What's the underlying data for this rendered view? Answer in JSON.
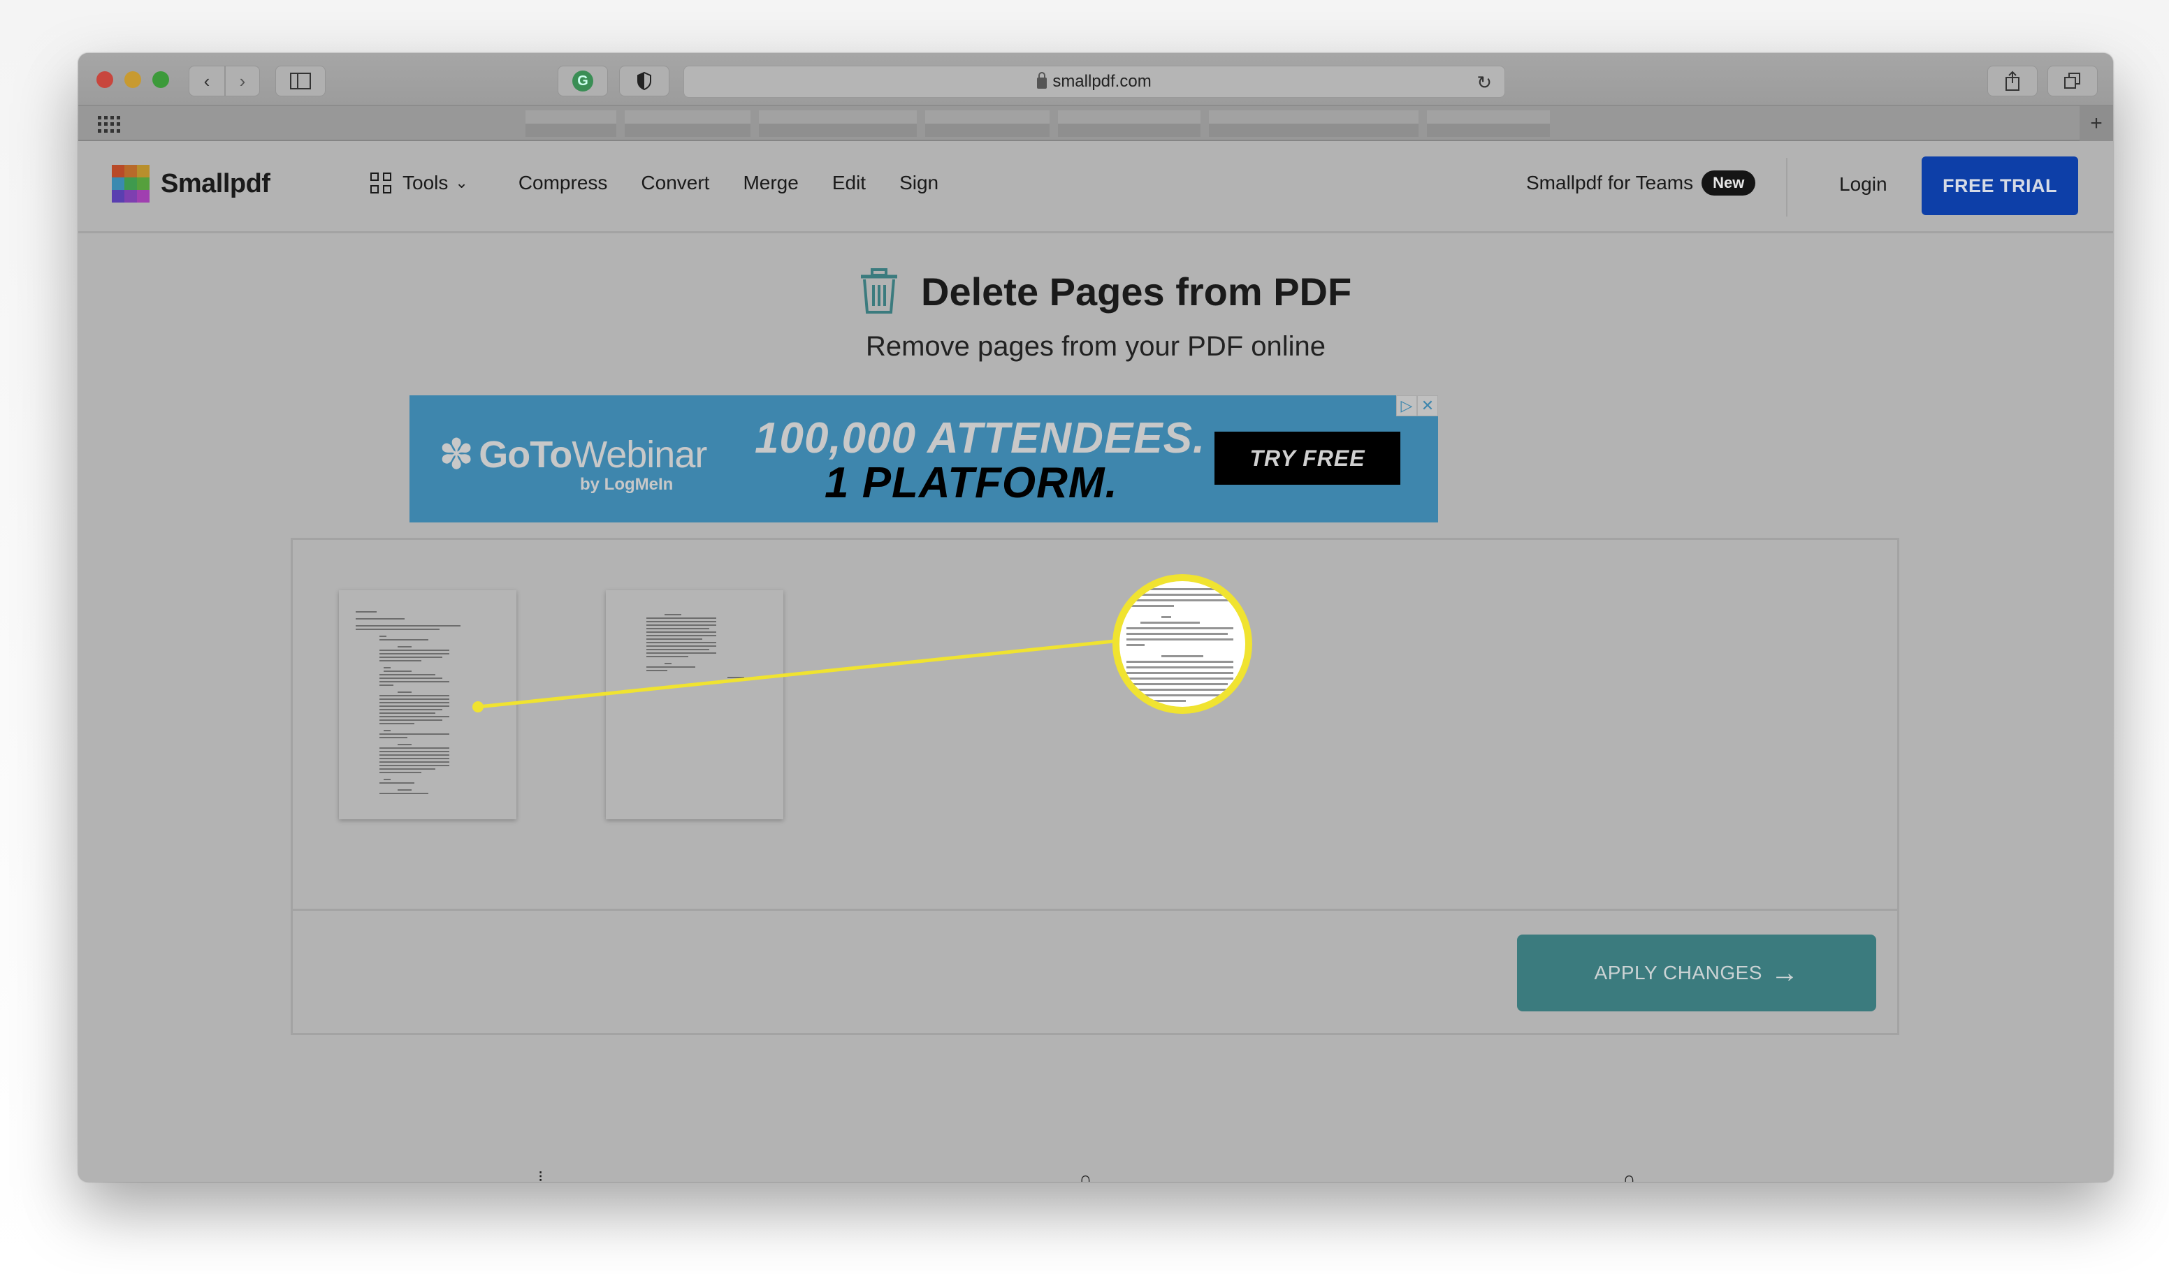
{
  "browser": {
    "url": "smallpdf.com",
    "buttons": {
      "back": "back-icon",
      "forward": "forward-icon",
      "sidebar": "sidebar-icon",
      "grammarly": "G",
      "privacy": "shield-icon",
      "reload": "reload-icon",
      "share": "share-icon",
      "tabs": "tabs-icon",
      "new_tab": "+"
    }
  },
  "site_nav": {
    "brand": "Smallpdf",
    "tools_label": "Tools",
    "links": [
      "Compress",
      "Convert",
      "Merge",
      "Edit",
      "Sign"
    ],
    "teams_label": "Smallpdf for Teams",
    "teams_badge": "New",
    "login_label": "Login",
    "cta_label": "FREE TRIAL",
    "cta_color": "#0d3fa8"
  },
  "hero": {
    "title": "Delete Pages from PDF",
    "subtitle": "Remove pages from your PDF online",
    "icon": "trash-icon",
    "accent_color": "#3b7b7e"
  },
  "ad": {
    "brand": "GoToWebinar",
    "brand_bold": "GoTo",
    "brand_light": "Webinar",
    "byline": "by LogMeIn",
    "headline_1": "100,000 ATTENDEES.",
    "headline_2": "1 PLATFORM.",
    "cta": "TRY FREE",
    "adchoices": "▷",
    "close": "✕"
  },
  "editor": {
    "pages": [
      {
        "label": "page-1"
      },
      {
        "label": "page-2"
      }
    ],
    "apply_label": "APPLY CHANGES",
    "apply_arrow": "→"
  },
  "annotation": {
    "type": "magnifier-callout",
    "color": "#f0e330"
  }
}
